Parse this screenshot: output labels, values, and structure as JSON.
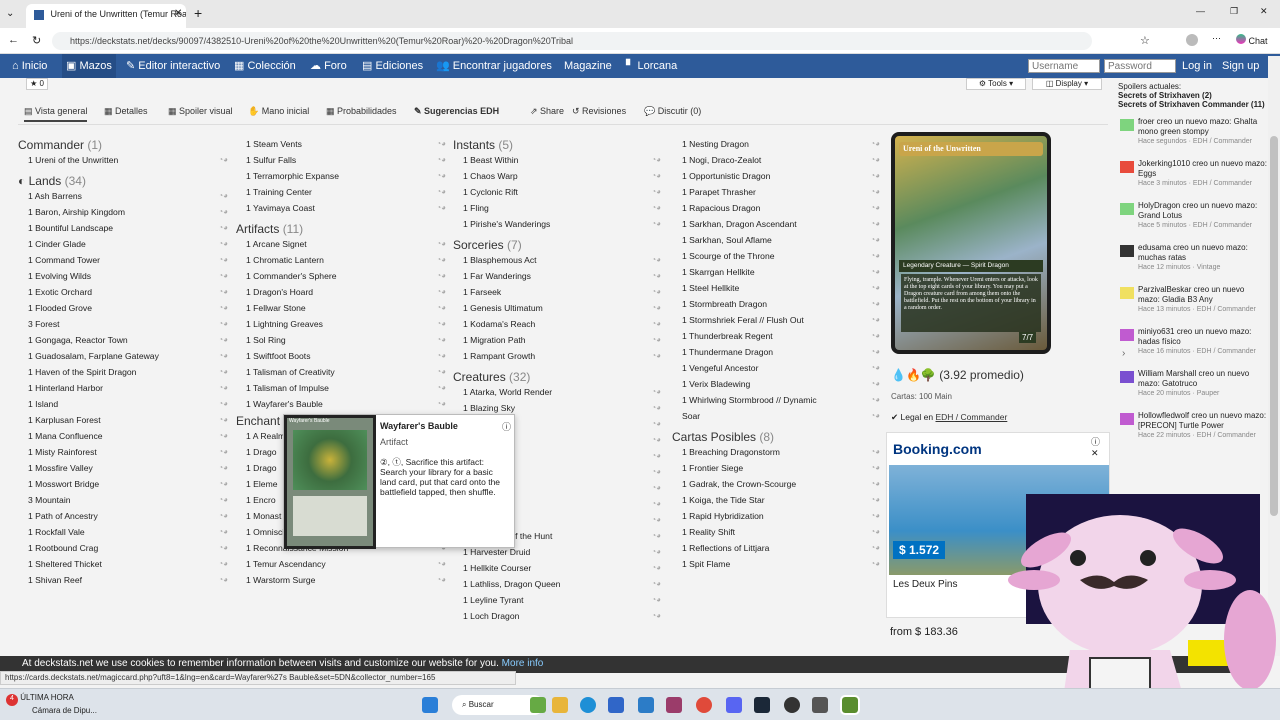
{
  "browser": {
    "tab_title": "Ureni of the Unwritten (Temur Roa",
    "url": "https://deckstats.net/decks/90097/4382510-Ureni%20of%20the%20Unwritten%20(Temur%20Roar)%20-%20Dragon%20Tribal",
    "chat": "Chat"
  },
  "nav": {
    "items": [
      "Inicio",
      "Mazos",
      "Editor interactivo",
      "Colección",
      "Foro",
      "Ediciones",
      "Encontrar jugadores",
      "Magazine",
      "Lorcana"
    ],
    "username_placeholder": "Username",
    "password_placeholder": "Password",
    "login": "Log in",
    "signup": "Sign up"
  },
  "toolbar": {
    "tools": "Tools",
    "display": "Display",
    "star": "0"
  },
  "subtabs": [
    "Vista general",
    "Detalles",
    "Spoiler visual",
    "Mano inicial",
    "Probabilidades",
    "Sugerencias EDH",
    "Share",
    "Revisiones",
    "Discutir (0)"
  ],
  "commander": {
    "title": "Commander",
    "count": "(1)",
    "cards": [
      "1 Ureni of the Unwritten"
    ]
  },
  "lands": {
    "title": "Lands",
    "count": "(34)",
    "cards": [
      "1 Ash Barrens",
      "1 Baron, Airship Kingdom",
      "1 Bountiful Landscape",
      "1 Cinder Glade",
      "1 Command Tower",
      "1 Evolving Wilds",
      "1 Exotic Orchard",
      "1 Flooded Grove",
      "3 Forest",
      "1 Gongaga, Reactor Town",
      "1 Guadosalam, Farplane Gateway",
      "1 Haven of the Spirit Dragon",
      "1 Hinterland Harbor",
      "1 Island",
      "1 Karplusan Forest",
      "1 Mana Confluence",
      "1 Misty Rainforest",
      "1 Mossfire Valley",
      "1 Mosswort Bridge",
      "3 Mountain",
      "1 Path of Ancestry",
      "1 Rockfall Vale",
      "1 Rootbound Crag",
      "1 Sheltered Thicket",
      "1 Shivan Reef"
    ]
  },
  "lands2": {
    "cards": [
      "1 Steam Vents",
      "1 Sulfur Falls",
      "1 Terramorphic Expanse",
      "1 Training Center",
      "1 Yavimaya Coast"
    ]
  },
  "artifacts": {
    "title": "Artifacts",
    "count": "(11)",
    "cards": [
      "1 Arcane Signet",
      "1 Chromatic Lantern",
      "1 Commander's Sphere",
      "1 Dragon's Hoard",
      "1 Fellwar Stone",
      "1 Lightning Greaves",
      "1 Sol Ring",
      "1 Swiftfoot Boots",
      "1 Talisman of Creativity",
      "1 Talisman of Impulse",
      "1 Wayfarer's Bauble"
    ]
  },
  "enchant": {
    "title": "Enchant",
    "cards": [
      "1 A Realm",
      "1 Drago",
      "1 Drago",
      "1 Eleme",
      "1 Encro",
      "1 Monast",
      "1 Omniscience",
      "1 Reconnaissance Mission",
      "1 Temur Ascendancy",
      "1 Warstorm Surge"
    ]
  },
  "instants": {
    "title": "Instants",
    "count": "(5)",
    "cards": [
      "1 Beast Within",
      "1 Chaos Warp",
      "1 Cyclonic Rift",
      "1 Fling",
      "1 Pirishe's Wanderings"
    ]
  },
  "sorceries": {
    "title": "Sorceries",
    "count": "(7)",
    "cards": [
      "1 Blasphemous Act",
      "1 Far Wanderings",
      "1 Farseek",
      "1 Genesis Ultimatum",
      "1 Kodama's Reach",
      "1 Migration Path",
      "1 Rampant Growth"
    ]
  },
  "creatures": {
    "title": "Creatures",
    "count": "(32)",
    "cards": [
      "1 Atarka, World Render",
      "1 Blazing Sky",
      "1 Scourge",
      "1 rostkite",
      "1 Atarka",
      "1 Servant",
      "1 ter Outcast",
      "1 oth",
      "1 nd Tyrant",
      "1 Harbinger of the Hunt",
      "1 Harvester Druid",
      "1 Hellkite Courser",
      "1 Lathliss, Dragon Queen",
      "1 Leyline Tyrant",
      "1 Loch Dragon"
    ]
  },
  "creatures2": {
    "cards": [
      "1 Nesting Dragon",
      "1 Nogi, Draco-Zealot",
      "1 Opportunistic Dragon",
      "1 Parapet Thrasher",
      "1 Rapacious Dragon",
      "1 Sarkhan, Dragon Ascendant",
      "1 Sarkhan, Soul Aflame",
      "1 Scourge of the Throne",
      "1 Skarrgan Hellkite",
      "1 Steel Hellkite",
      "1 Stormbreath Dragon",
      "1 Stormshriek Feral // Flush Out",
      "1 Thunderbreak Regent",
      "1 Thundermane Dragon",
      "1 Vengeful Ancestor",
      "1 Verix Bladewing",
      "1 Whirlwing Stormbrood // Dynamic",
      "Soar"
    ]
  },
  "planeswalkers": {
    "title": "Cartas Posibles",
    "count": "(8)",
    "cards": [
      "1 Breaching Dragonstorm",
      "1 Frontier Siege",
      "1 Gadrak, the Crown-Scourge",
      "1 Koiga, the Tide Star",
      "1 Rapid Hybridization",
      "1 Reality Shift",
      "1 Reflections of Littjara",
      "1 Spit Flame"
    ]
  },
  "tooltip": {
    "name": "Wayfarer's Bauble",
    "type": "Artifact",
    "text": ", Sacrifice this artifact: Search your library for a basic land card, put that card onto the battlefield tapped, then shuffle.",
    "img_title": "Wayfarer's Bauble"
  },
  "featured": {
    "name": "Ureni of the Unwritten",
    "type": "Legendary Creature — Spirit Dragon",
    "text": "Flying, trample. Whenever Ureni enters or attacks, look at the top eight cards of your library. You may put a Dragon creature card from among them onto the battlefield. Put the rest on the bottom of your library in a random order.",
    "pt": "7/7",
    "avg": "(3.92 promedio)",
    "cards": "Cartas: 100 Main",
    "legal_prefix": "Legal en",
    "legal_link": "EDH / Commander"
  },
  "sidebar": {
    "header": "Spoilers actuales:",
    "spoilers": [
      "Secrets of Strixhaven (2)",
      "Secrets of Strixhaven Commander (11)"
    ],
    "feed": [
      {
        "text": "froer creo un nuevo mazo: Ghalta mono green stompy",
        "time": "Hace segundos · EDH / Commander",
        "color": "#7ed47e"
      },
      {
        "text": "Jokerking1010 creo un nuevo mazo: Eggs",
        "time": "Hace 3 minutos · EDH / Commander",
        "color": "#e84b3c"
      },
      {
        "text": "HolyDragon creo un nuevo mazo: Grand Lotus",
        "time": "Hace 5 minutos · EDH / Commander",
        "color": "#7ed47e"
      },
      {
        "text": "edusama creo un nuevo mazo: muchas ratas",
        "time": "Hace 12 minutos · Vintage",
        "color": "#333333"
      },
      {
        "text": "ParzivalBeskar creo un nuevo mazo: Gladia B3 Any",
        "time": "Hace 13 minutos · EDH / Commander",
        "color": "#f0e060"
      },
      {
        "text": "miniyo631 creo un nuevo mazo: hadas físico",
        "time": "Hace 16 minutos · EDH / Commander",
        "color": "#c05bd0"
      },
      {
        "text": "William Marshall creo un nuevo mazo: Gatotruco",
        "time": "Hace 20 minutos · Pauper",
        "color": "#7a4fd0"
      },
      {
        "text": "Hollowfledwolf creo un nuevo mazo: [PRECON] Turtle Power",
        "time": "Hace 22 minutos · EDH / Commander",
        "color": "#c05bd0"
      }
    ]
  },
  "ad": {
    "brand": "Booking.com",
    "price": "$ 1.572",
    "hotel": "Les Deux Pins",
    "from": "from $ 183.36"
  },
  "cookie": {
    "text": "At deckstats.net we use cookies to remember information between visits and customize our website for you.",
    "more": "More info"
  },
  "status_url": "https://cards.deckstats.net/magiccard.php?uft8=1&lng=en&card=Wayfarer%27s Bauble&set=5DN&collector_number=165",
  "taskbar": {
    "badge": "4",
    "news_title": "ÚLTIMA HORA",
    "news_sub": "Cámara de Dipu...",
    "search": "Buscar"
  }
}
